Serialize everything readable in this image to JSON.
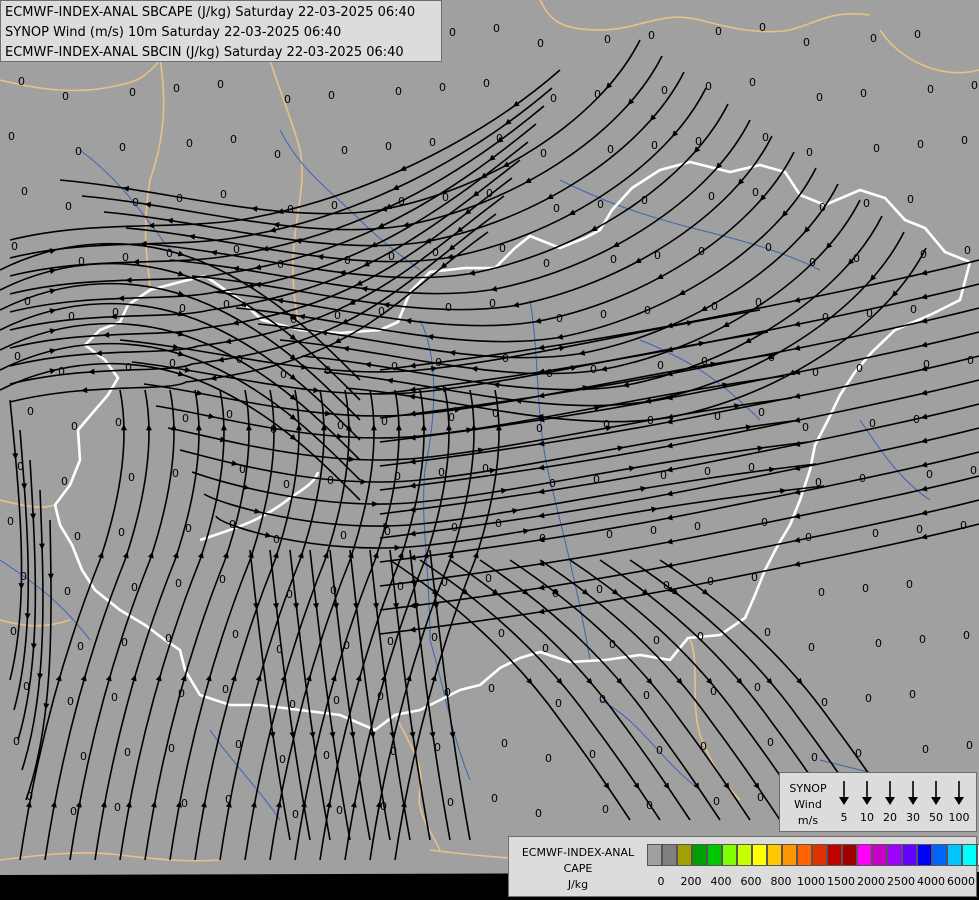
{
  "header": {
    "line1": "ECMWF-INDEX-ANAL SBCAPE (J/kg) Saturday 22-03-2025 06:40",
    "line2": "SYNOP Wind (m/s) 10m Saturday 22-03-2025 06:40",
    "line3": "ECMWF-INDEX-ANAL SBCIN (J/kg) Saturday 22-03-2025 06:40"
  },
  "wind_legend": {
    "title1": "SYNOP",
    "title2": "Wind",
    "title3": "m/s",
    "values": [
      "5",
      "10",
      "20",
      "30",
      "50",
      "100"
    ]
  },
  "cape_legend": {
    "title1": "ECMWF-INDEX-ANAL",
    "title2": "CAPE",
    "title3": "J/kg",
    "labels": [
      "0",
      "200",
      "400",
      "600",
      "800",
      "1000",
      "1500",
      "2000",
      "2500",
      "4000",
      "6000"
    ],
    "colors": [
      "#a0a0a0",
      "#808080",
      "#a0a000",
      "#00a000",
      "#00c800",
      "#80ff00",
      "#c8ff00",
      "#ffff00",
      "#ffc800",
      "#ff9600",
      "#ff6400",
      "#e03200",
      "#c00000",
      "#a00000",
      "#ff00ff",
      "#c800c8",
      "#a000ff",
      "#6400ff",
      "#0000ff",
      "#0064ff",
      "#00c8ff",
      "#00ffff",
      "#e6ffff",
      "#ffffff"
    ]
  },
  "map": {
    "background": "#a0a0a0",
    "border_color": "#ffffff",
    "neighbor_border_color": "#e8c08a",
    "river_color": "#3c64b4",
    "field_value": "0"
  }
}
